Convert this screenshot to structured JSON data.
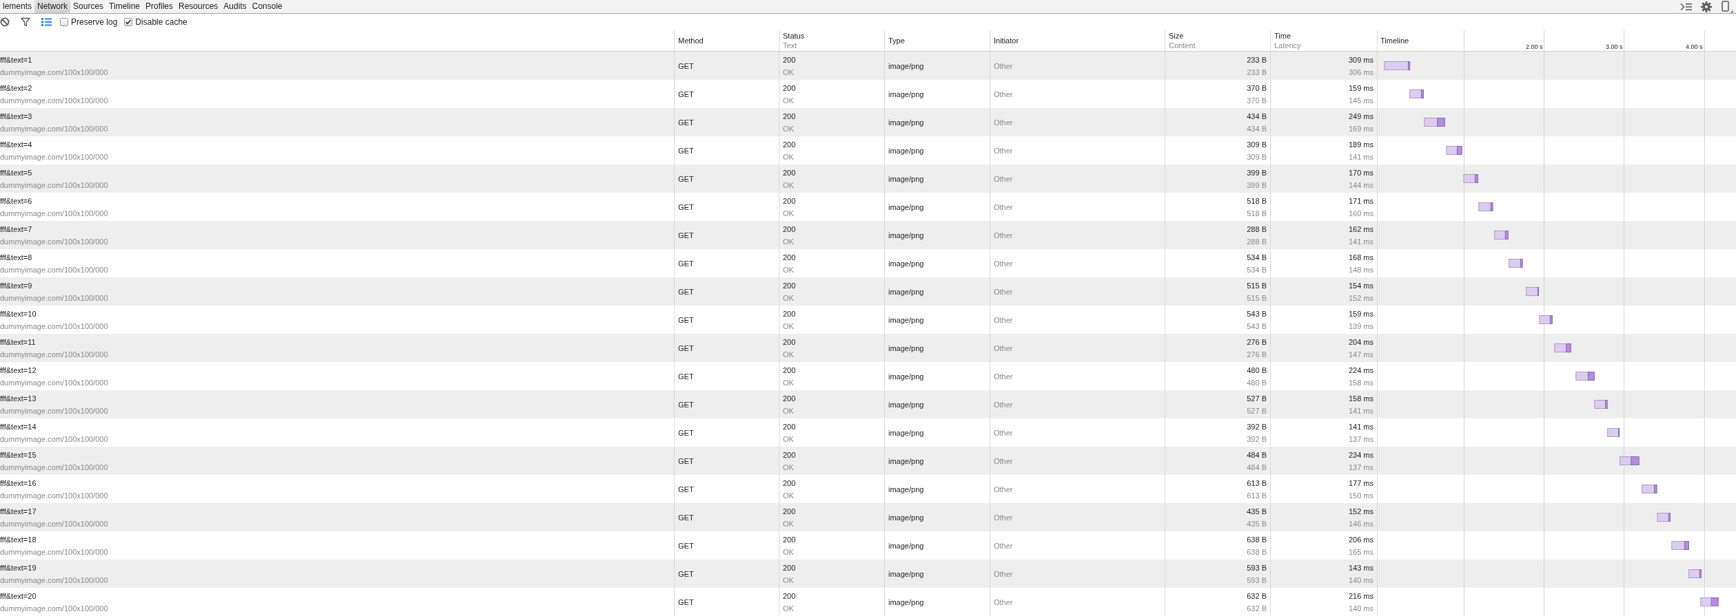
{
  "tabs": [
    {
      "label": "lements",
      "selected": false
    },
    {
      "label": "Network",
      "selected": true
    },
    {
      "label": "Sources",
      "selected": false
    },
    {
      "label": "Timeline",
      "selected": false
    },
    {
      "label": "Profiles",
      "selected": false
    },
    {
      "label": "Resources",
      "selected": false
    },
    {
      "label": "Audits",
      "selected": false
    },
    {
      "label": "Console",
      "selected": false
    }
  ],
  "panel_buttons": [
    {
      "kind": "drawer"
    },
    {
      "kind": "settings"
    },
    {
      "kind": "device"
    }
  ],
  "toolbar": {
    "buttons": [
      {
        "kind": "clear",
        "active": false
      },
      {
        "kind": "filter",
        "active": false
      },
      {
        "kind": "large_rows",
        "active": true
      }
    ],
    "checkboxes": [
      {
        "label": "Preserve log",
        "checked": false
      },
      {
        "label": "Disable cache",
        "checked": true
      }
    ]
  },
  "table": {
    "columns": [
      {
        "title": "Method"
      },
      {
        "title": "Status",
        "subtitle": "Text"
      },
      {
        "title": "Type"
      },
      {
        "title": "Initiator"
      },
      {
        "title": "Size",
        "subtitle": "Content"
      },
      {
        "title": "Time",
        "subtitle": "Latency"
      }
    ],
    "rows": [
      {
        "name": "fff&text=1",
        "path": "dummyimage.com/100x100/000",
        "method": "GET",
        "status": "200",
        "status_text": "OK",
        "type": "image/png",
        "initiator": "Other",
        "size": "233 B",
        "content": "233 B",
        "time": "309 ms",
        "latency": "306 ms"
      },
      {
        "name": "fff&text=2",
        "path": "dummyimage.com/100x100/000",
        "method": "GET",
        "status": "200",
        "status_text": "OK",
        "type": "image/png",
        "initiator": "Other",
        "size": "370 B",
        "content": "370 B",
        "time": "159 ms",
        "latency": "145 ms"
      },
      {
        "name": "fff&text=3",
        "path": "dummyimage.com/100x100/000",
        "method": "GET",
        "status": "200",
        "status_text": "OK",
        "type": "image/png",
        "initiator": "Other",
        "size": "434 B",
        "content": "434 B",
        "time": "249 ms",
        "latency": "169 ms"
      },
      {
        "name": "fff&text=4",
        "path": "dummyimage.com/100x100/000",
        "method": "GET",
        "status": "200",
        "status_text": "OK",
        "type": "image/png",
        "initiator": "Other",
        "size": "309 B",
        "content": "309 B",
        "time": "189 ms",
        "latency": "141 ms"
      },
      {
        "name": "fff&text=5",
        "path": "dummyimage.com/100x100/000",
        "method": "GET",
        "status": "200",
        "status_text": "OK",
        "type": "image/png",
        "initiator": "Other",
        "size": "399 B",
        "content": "399 B",
        "time": "170 ms",
        "latency": "144 ms"
      },
      {
        "name": "fff&text=6",
        "path": "dummyimage.com/100x100/000",
        "method": "GET",
        "status": "200",
        "status_text": "OK",
        "type": "image/png",
        "initiator": "Other",
        "size": "518 B",
        "content": "518 B",
        "time": "171 ms",
        "latency": "160 ms"
      },
      {
        "name": "fff&text=7",
        "path": "dummyimage.com/100x100/000",
        "method": "GET",
        "status": "200",
        "status_text": "OK",
        "type": "image/png",
        "initiator": "Other",
        "size": "288 B",
        "content": "288 B",
        "time": "162 ms",
        "latency": "141 ms"
      },
      {
        "name": "fff&text=8",
        "path": "dummyimage.com/100x100/000",
        "method": "GET",
        "status": "200",
        "status_text": "OK",
        "type": "image/png",
        "initiator": "Other",
        "size": "534 B",
        "content": "534 B",
        "time": "168 ms",
        "latency": "148 ms"
      },
      {
        "name": "fff&text=9",
        "path": "dummyimage.com/100x100/000",
        "method": "GET",
        "status": "200",
        "status_text": "OK",
        "type": "image/png",
        "initiator": "Other",
        "size": "515 B",
        "content": "515 B",
        "time": "154 ms",
        "latency": "152 ms"
      },
      {
        "name": "fff&text=10",
        "path": "dummyimage.com/100x100/000",
        "method": "GET",
        "status": "200",
        "status_text": "OK",
        "type": "image/png",
        "initiator": "Other",
        "size": "543 B",
        "content": "543 B",
        "time": "159 ms",
        "latency": "139 ms"
      },
      {
        "name": "fff&text=11",
        "path": "dummyimage.com/100x100/000",
        "method": "GET",
        "status": "200",
        "status_text": "OK",
        "type": "image/png",
        "initiator": "Other",
        "size": "276 B",
        "content": "276 B",
        "time": "204 ms",
        "latency": "147 ms"
      },
      {
        "name": "fff&text=12",
        "path": "dummyimage.com/100x100/000",
        "method": "GET",
        "status": "200",
        "status_text": "OK",
        "type": "image/png",
        "initiator": "Other",
        "size": "480 B",
        "content": "480 B",
        "time": "224 ms",
        "latency": "158 ms"
      },
      {
        "name": "fff&text=13",
        "path": "dummyimage.com/100x100/000",
        "method": "GET",
        "status": "200",
        "status_text": "OK",
        "type": "image/png",
        "initiator": "Other",
        "size": "527 B",
        "content": "527 B",
        "time": "158 ms",
        "latency": "141 ms"
      },
      {
        "name": "fff&text=14",
        "path": "dummyimage.com/100x100/000",
        "method": "GET",
        "status": "200",
        "status_text": "OK",
        "type": "image/png",
        "initiator": "Other",
        "size": "392 B",
        "content": "392 B",
        "time": "141 ms",
        "latency": "137 ms"
      },
      {
        "name": "fff&text=15",
        "path": "dummyimage.com/100x100/000",
        "method": "GET",
        "status": "200",
        "status_text": "OK",
        "type": "image/png",
        "initiator": "Other",
        "size": "484 B",
        "content": "484 B",
        "time": "234 ms",
        "latency": "137 ms"
      },
      {
        "name": "fff&text=16",
        "path": "dummyimage.com/100x100/000",
        "method": "GET",
        "status": "200",
        "status_text": "OK",
        "type": "image/png",
        "initiator": "Other",
        "size": "613 B",
        "content": "613 B",
        "time": "177 ms",
        "latency": "150 ms"
      },
      {
        "name": "fff&text=17",
        "path": "dummyimage.com/100x100/000",
        "method": "GET",
        "status": "200",
        "status_text": "OK",
        "type": "image/png",
        "initiator": "Other",
        "size": "435 B",
        "content": "435 B",
        "time": "152 ms",
        "latency": "146 ms"
      },
      {
        "name": "fff&text=18",
        "path": "dummyimage.com/100x100/000",
        "method": "GET",
        "status": "200",
        "status_text": "OK",
        "type": "image/png",
        "initiator": "Other",
        "size": "638 B",
        "content": "638 B",
        "time": "206 ms",
        "latency": "165 ms"
      },
      {
        "name": "fff&text=19",
        "path": "dummyimage.com/100x100/000",
        "method": "GET",
        "status": "200",
        "status_text": "OK",
        "type": "image/png",
        "initiator": "Other",
        "size": "593 B",
        "content": "593 B",
        "time": "143 ms",
        "latency": "140 ms"
      },
      {
        "name": "fff&text=20",
        "path": "dummyimage.com/100x100/000",
        "method": "GET",
        "status": "200",
        "status_text": "OK",
        "type": "image/png",
        "initiator": "Other",
        "size": "632 B",
        "content": "632 B",
        "time": "216 ms",
        "latency": "140 ms"
      }
    ]
  },
  "timeline": {
    "title": "Timeline",
    "ticks": [
      "2.00 s",
      "3.00 s",
      "4.00 s"
    ]
  }
}
